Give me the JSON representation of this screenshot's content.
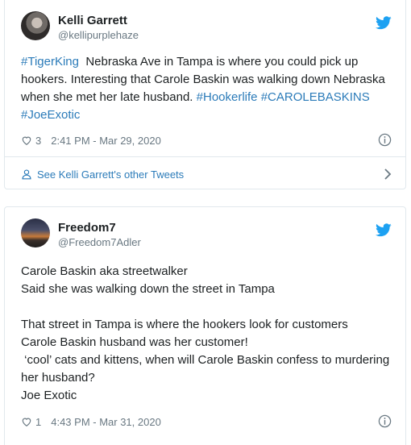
{
  "tweets": [
    {
      "author": "Kelli Garrett",
      "handle": "@kellipurplehaze",
      "body": [
        [
          {
            "t": "#TigerKing",
            "tag": true
          },
          {
            "t": "  Nebraska Ave in Tampa is where you could pick up hookers. Interesting that Carole Baskin was walking down Nebraska when she met her late husband. "
          },
          {
            "t": "#Hookerlife",
            "tag": true
          },
          {
            "t": " "
          },
          {
            "t": "#CAROLEBASKINS",
            "tag": true
          },
          {
            "t": " "
          },
          {
            "t": "#JoeExotic",
            "tag": true
          }
        ]
      ],
      "likes": "3",
      "timestamp": "2:41 PM - Mar 29, 2020",
      "more_link": "See Kelli Garrett's other Tweets"
    },
    {
      "author": "Freedom7",
      "handle": "@Freedom7Adler",
      "lines": [
        "Carole Baskin aka streetwalker",
        "Said she was walking down the street in Tampa",
        "",
        "That street in Tampa is where the hookers look for customers",
        "Carole Baskin husband was her customer!",
        " ‘cool’ cats and kittens, when will Carole Baskin confess to murdering her husband?",
        "Joe Exotic"
      ],
      "likes": "1",
      "timestamp": "4:43 PM - Mar 31, 2020"
    }
  ],
  "colors": {
    "link": "#2b7bb9",
    "twitter_blue": "#1da1f2",
    "meta_gray": "#697882",
    "border": "#e1e8ed"
  },
  "icons": {
    "brand": "twitter-bird-icon",
    "like": "heart-icon",
    "info": "info-icon",
    "profile": "person-icon",
    "more": "chevron-right-icon"
  }
}
